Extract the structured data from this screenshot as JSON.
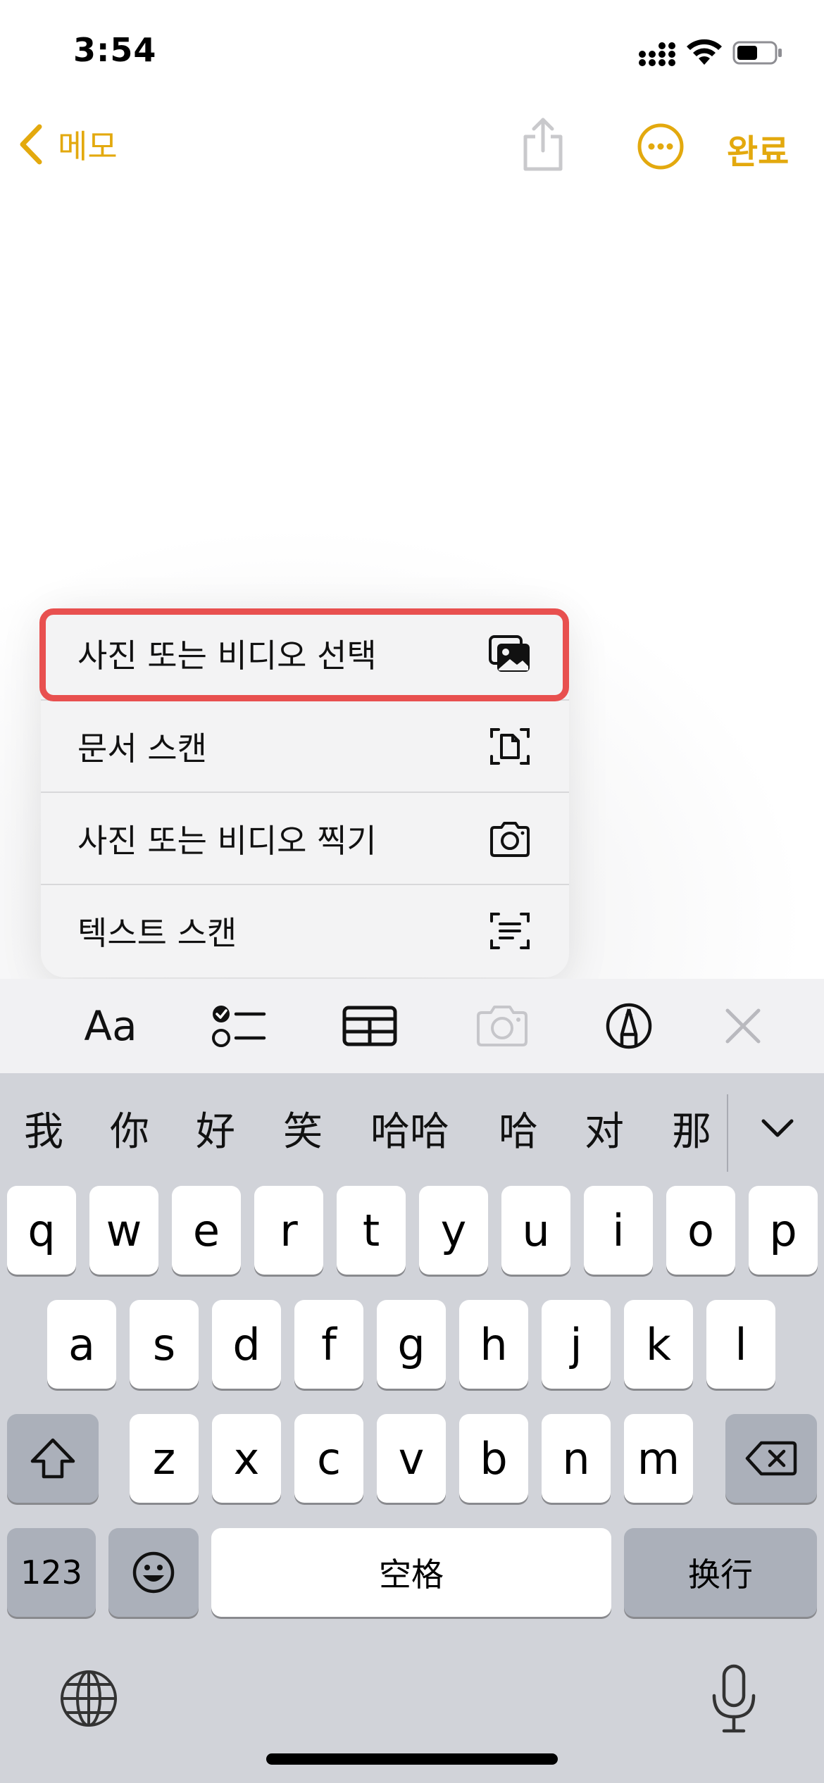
{
  "status": {
    "time": "3:54"
  },
  "nav": {
    "back_label": "메모",
    "done_label": "완료",
    "accent_color": "#e3a90e"
  },
  "menu": {
    "items": [
      {
        "label": "사진 또는 비디오 선택",
        "icon": "photo-library-icon"
      },
      {
        "label": "문서 스캔",
        "icon": "document-scan-icon"
      },
      {
        "label": "사진 또는 비디오 찍기",
        "icon": "camera-icon"
      },
      {
        "label": "텍스트 스캔",
        "icon": "text-scan-icon"
      }
    ],
    "highlight_color": "#e8504f"
  },
  "toolbar": {
    "format_label": "Aa",
    "icons": [
      "checklist-icon",
      "table-icon",
      "camera-icon",
      "markup-pen-icon",
      "close-icon"
    ]
  },
  "keyboard": {
    "candidates": [
      "我",
      "你",
      "好",
      "笑",
      "哈哈",
      "哈",
      "对",
      "那"
    ],
    "row1": [
      "q",
      "w",
      "e",
      "r",
      "t",
      "y",
      "u",
      "i",
      "o",
      "p"
    ],
    "row2": [
      "a",
      "s",
      "d",
      "f",
      "g",
      "h",
      "j",
      "k",
      "l"
    ],
    "row3": [
      "z",
      "x",
      "c",
      "v",
      "b",
      "n",
      "m"
    ],
    "numbers_label": "123",
    "space_label": "空格",
    "return_label": "换行"
  }
}
